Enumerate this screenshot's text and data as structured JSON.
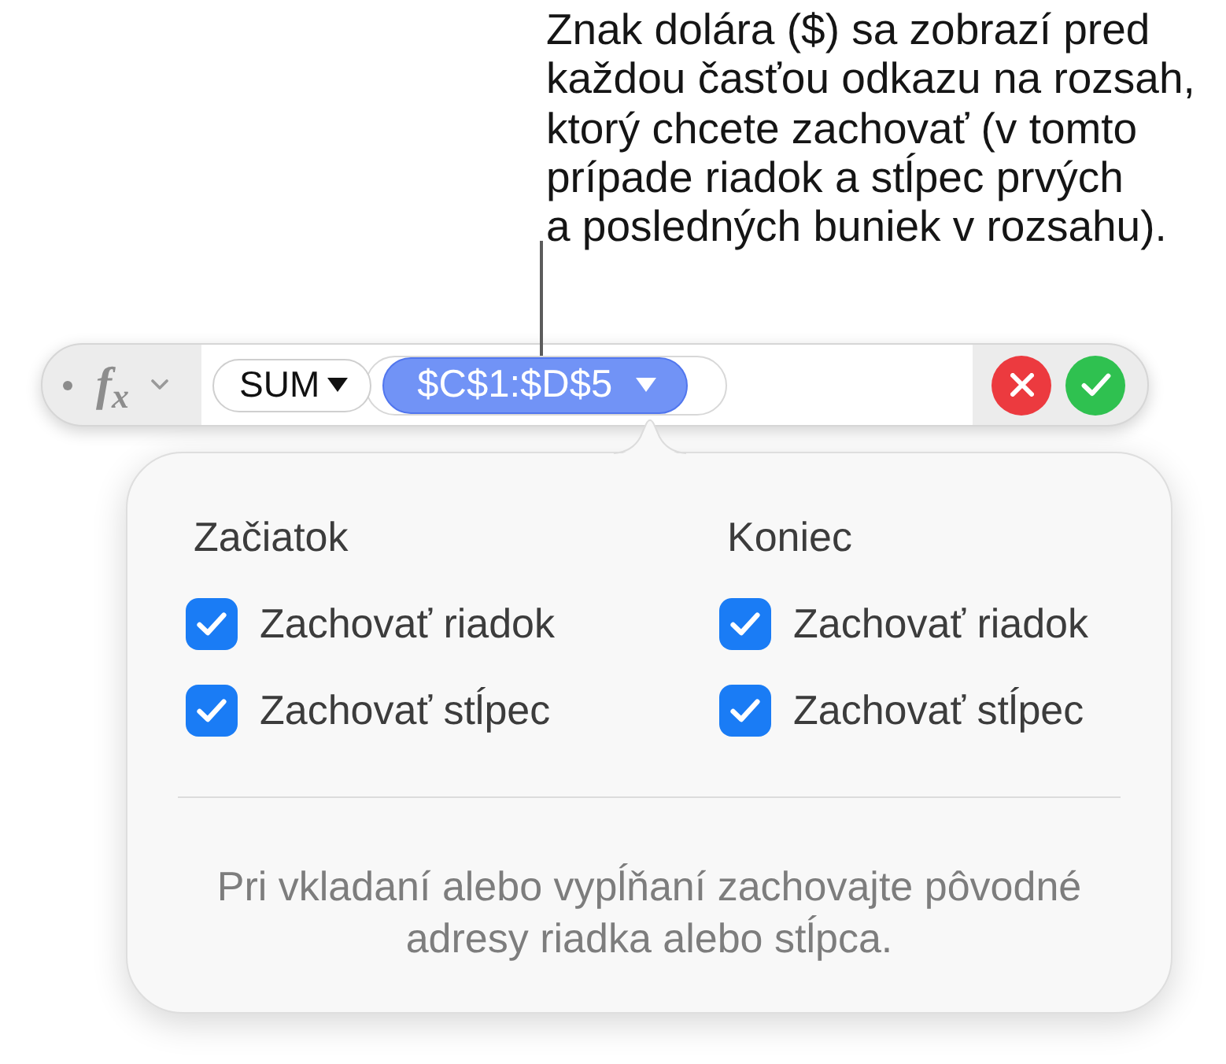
{
  "callout": {
    "text": "Znak dolára ($) sa zobrazí pred\nkaždou časťou odkazu na rozsah,\nktorý chcete zachovať (v tomto\nprípade riadok a stĺpec prvých\na posledných buniek v rozsahu)."
  },
  "formula_bar": {
    "function_symbol": "f$_{x}$",
    "function": {
      "name": "SUM",
      "arguments": [
        {
          "text": "$C$1:$D$5",
          "selected": true
        }
      ]
    },
    "buttons": [
      {
        "kind": "cancel"
      },
      {
        "kind": "confirm"
      }
    ]
  },
  "popover": {
    "sections": [
      {
        "title": "Začiatok",
        "options": [
          {
            "label": "Zachovať riadok",
            "checked": true
          },
          {
            "label": "Zachovať stĺpec",
            "checked": true
          }
        ]
      },
      {
        "title": "Koniec",
        "options": [
          {
            "label": "Zachovať riadok",
            "checked": true
          },
          {
            "label": "Zachovať stĺpec",
            "checked": true
          }
        ]
      }
    ],
    "note": "Pri vkladaní alebo vypĺňaní zachovajte pôvodné\nadresy riadka alebo stĺpca."
  }
}
